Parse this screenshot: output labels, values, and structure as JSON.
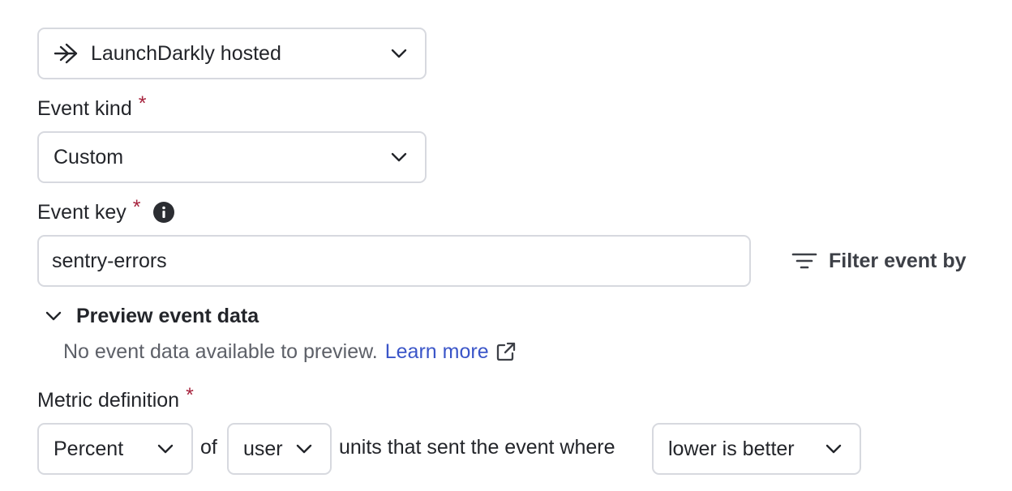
{
  "data_source": {
    "value": "LaunchDarkly hosted",
    "icon": "arrow-icon"
  },
  "event_kind": {
    "label": "Event kind",
    "required_mark": "*",
    "value": "Custom"
  },
  "event_key": {
    "label": "Event key",
    "required_mark": "*",
    "value": "sentry-errors",
    "info_icon": "info-icon"
  },
  "filter": {
    "label": "Filter event by",
    "icon": "filter-icon"
  },
  "preview": {
    "title": "Preview event data",
    "empty_text": "No event data available to preview.",
    "learn_more": "Learn more",
    "learn_more_icon": "external-link-icon"
  },
  "metric": {
    "label": "Metric definition",
    "required_mark": "*",
    "aggregation": "Percent",
    "of_text": "of",
    "unit": "user",
    "middle_text": "units that sent the event where",
    "direction": "lower is better"
  },
  "colors": {
    "required": "#a7233d",
    "link": "#3a55c8",
    "border": "#d7d9df",
    "text": "#23252a",
    "muted": "#5d6068"
  }
}
